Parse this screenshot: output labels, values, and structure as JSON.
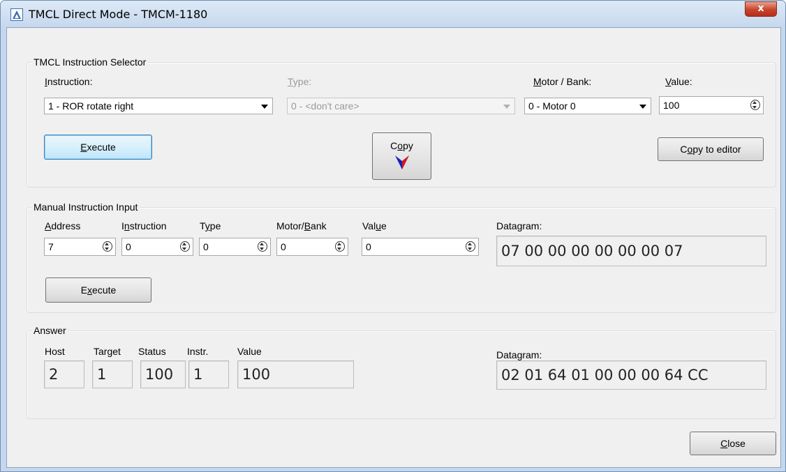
{
  "window": {
    "title": "TMCL Direct Mode - TMCM-1180",
    "close_glyph": "x"
  },
  "selector": {
    "title": "TMCL Instruction Selector",
    "instruction_label": "Instruction:",
    "instruction_value": "1 - ROR rotate right",
    "type_label": "Type:",
    "type_value": "0 -  <don't care>",
    "motor_label": "Motor / Bank:",
    "motor_value": "0 - Motor 0",
    "value_label": "Value:",
    "value_value": "100",
    "execute_label": "Execute",
    "copy_label": "Copy",
    "copy_to_editor_label": "Copy to editor"
  },
  "manual": {
    "title": "Manual Instruction Input",
    "address_label": "Address",
    "instruction_label": "Instruction",
    "type_label": "Type",
    "motor_label": "Motor/Bank",
    "value_label": "Value",
    "datagram_label": "Datagram:",
    "address_value": "7",
    "instruction_value": "0",
    "type_value": "0",
    "motor_value": "0",
    "value_value": "0",
    "datagram_value": "07 00 00 00 00 00 00 07",
    "execute_label": "Execute"
  },
  "answer": {
    "title": "Answer",
    "host_label": "Host",
    "target_label": "Target",
    "status_label": "Status",
    "instr_label": "Instr.",
    "value_label": "Value",
    "datagram_label": "Datagram:",
    "host_value": "2",
    "target_value": "1",
    "status_value": "100",
    "instr_value": "1",
    "value_value": "100",
    "datagram_value": "02 01 64 01 00 00 00 64 CC"
  },
  "footer": {
    "close_label": "Close"
  },
  "colors": {
    "accent": "#3c7fb1",
    "close_button": "#c7432a",
    "copy_arrow": "#1c1fb8"
  },
  "icons": {
    "app": "tmcl-logo-icon",
    "spin": "spin-updown-icon",
    "dropdown": "dropdown-arrow-icon",
    "copy": "copy-down-arrow-icon"
  }
}
